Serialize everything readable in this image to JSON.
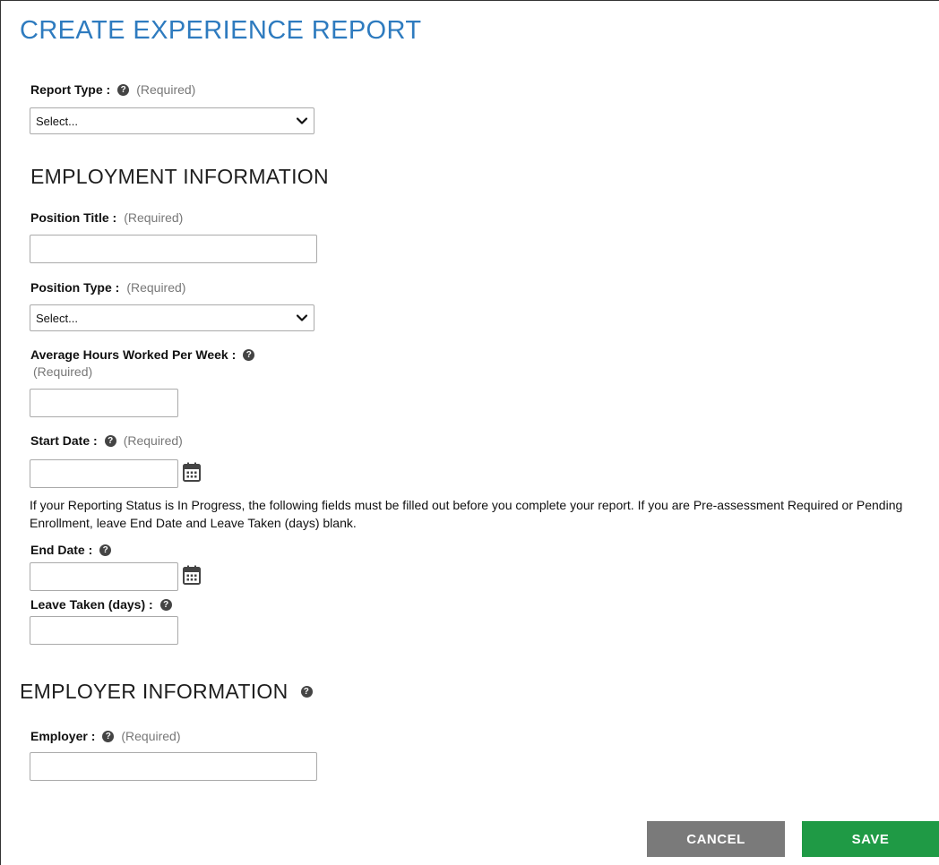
{
  "page": {
    "title": "CREATE EXPERIENCE REPORT"
  },
  "common": {
    "required": "(Required)",
    "help_glyph": "?"
  },
  "report_type": {
    "label": "Report Type :",
    "selected": "Select..."
  },
  "employment": {
    "heading": "EMPLOYMENT INFORMATION",
    "position_title": {
      "label": "Position Title :",
      "value": ""
    },
    "position_type": {
      "label": "Position Type :",
      "selected": "Select..."
    },
    "avg_hours": {
      "label": "Average Hours Worked Per Week :",
      "value": ""
    },
    "start_date": {
      "label": "Start Date :",
      "value": ""
    },
    "note": "If your Reporting Status is In Progress, the following fields must be filled out before you complete your report. If you are Pre-assessment Required or Pending Enrollment, leave End Date and Leave Taken (days) blank.",
    "end_date": {
      "label": "End Date :",
      "value": ""
    },
    "leave_taken": {
      "label": "Leave Taken (days) :",
      "value": ""
    }
  },
  "employer": {
    "heading": "EMPLOYER INFORMATION",
    "employer": {
      "label": "Employer :",
      "value": ""
    }
  },
  "actions": {
    "cancel": "CANCEL",
    "save": "SAVE"
  },
  "icons": {
    "help": "question-circle-icon",
    "chevron": "chevron-down-icon",
    "calendar": "calendar-icon"
  }
}
